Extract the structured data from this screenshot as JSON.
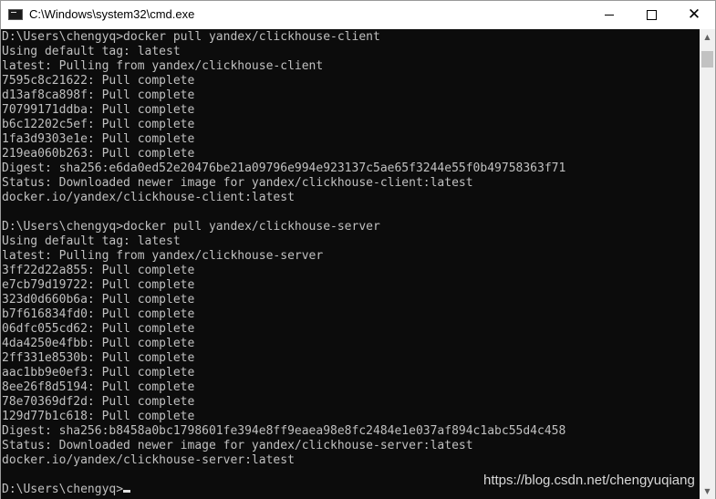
{
  "window": {
    "title": "C:\\Windows\\system32\\cmd.exe"
  },
  "icons": {
    "app": "cmd-console-icon",
    "minimize": "minimize-icon",
    "maximize": "maximize-icon",
    "close": "close-icon"
  },
  "console": {
    "lines": [
      "D:\\Users\\chengyq>docker pull yandex/clickhouse-client",
      "Using default tag: latest",
      "latest: Pulling from yandex/clickhouse-client",
      "7595c8c21622: Pull complete",
      "d13af8ca898f: Pull complete",
      "70799171ddba: Pull complete",
      "b6c12202c5ef: Pull complete",
      "1fa3d9303e1e: Pull complete",
      "219ea060b263: Pull complete",
      "Digest: sha256:e6da0ed52e20476be21a09796e994e923137c5ae65f3244e55f0b49758363f71",
      "Status: Downloaded newer image for yandex/clickhouse-client:latest",
      "docker.io/yandex/clickhouse-client:latest",
      "",
      "D:\\Users\\chengyq>docker pull yandex/clickhouse-server",
      "Using default tag: latest",
      "latest: Pulling from yandex/clickhouse-server",
      "3ff22d22a855: Pull complete",
      "e7cb79d19722: Pull complete",
      "323d0d660b6a: Pull complete",
      "b7f616834fd0: Pull complete",
      "06dfc055cd62: Pull complete",
      "4da4250e4fbb: Pull complete",
      "2ff331e8530b: Pull complete",
      "aac1bb9e0ef3: Pull complete",
      "8ee26f8d5194: Pull complete",
      "78e70369df2d: Pull complete",
      "129d77b1c618: Pull complete",
      "Digest: sha256:b8458a0bc1798601fe394e8ff9eaea98e8fc2484e1e037af894c1abc55d4c458",
      "Status: Downloaded newer image for yandex/clickhouse-server:latest",
      "docker.io/yandex/clickhouse-server:latest",
      "",
      "D:\\Users\\chengyq>"
    ]
  },
  "watermark": "https://blog.csdn.net/chengyuqiang",
  "colors": {
    "console_bg": "#0c0c0c",
    "console_text": "#c0c0c0",
    "titlebar_bg": "#ffffff"
  }
}
